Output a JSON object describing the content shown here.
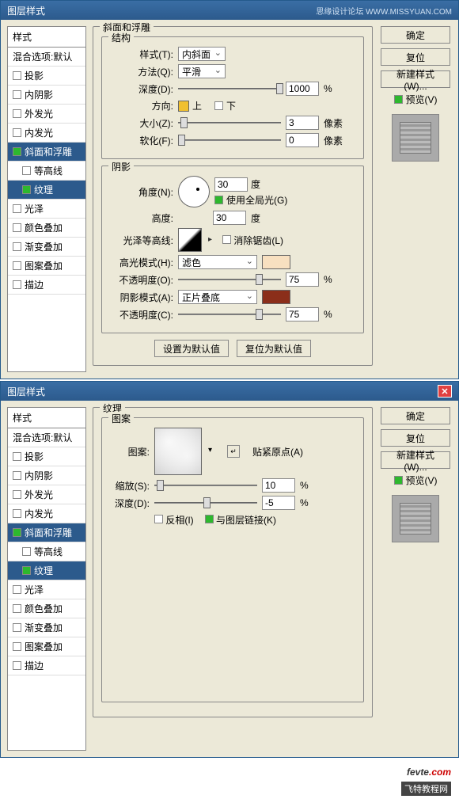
{
  "dialog1": {
    "title": "图层样式",
    "watermark": "思缘设计论坛  WWW.MISSYUAN.COM",
    "styles_header": "样式",
    "blend_default": "混合选项:默认",
    "items": {
      "drop_shadow": "投影",
      "inner_shadow": "内阴影",
      "outer_glow": "外发光",
      "inner_glow": "内发光",
      "bevel": "斜面和浮雕",
      "contour": "等高线",
      "texture": "纹理",
      "satin": "光泽",
      "color_overlay": "颜色叠加",
      "grad_overlay": "渐变叠加",
      "pattern_overlay": "图案叠加",
      "stroke": "描边"
    },
    "panel_title": "斜面和浮雕",
    "structure": {
      "title": "结构",
      "style_lbl": "样式(T):",
      "style_val": "内斜面",
      "method_lbl": "方法(Q):",
      "method_val": "平滑",
      "depth_lbl": "深度(D):",
      "depth_val": "1000",
      "depth_unit": "%",
      "dir_lbl": "方向:",
      "dir_up": "上",
      "dir_down": "下",
      "size_lbl": "大小(Z):",
      "size_val": "3",
      "size_unit": "像素",
      "soften_lbl": "软化(F):",
      "soften_val": "0",
      "soften_unit": "像素"
    },
    "shading": {
      "title": "阴影",
      "angle_lbl": "角度(N):",
      "angle_val": "30",
      "angle_unit": "度",
      "global_light": "使用全局光(G)",
      "altitude_lbl": "高度:",
      "altitude_val": "30",
      "altitude_unit": "度",
      "gloss_lbl": "光泽等高线:",
      "anti_alias": "消除锯齿(L)",
      "hl_mode_lbl": "高光模式(H):",
      "hl_mode_val": "滤色",
      "hl_color": "#f8e0c0",
      "hl_opacity_lbl": "不透明度(O):",
      "hl_opacity_val": "75",
      "pct": "%",
      "sh_mode_lbl": "阴影模式(A):",
      "sh_mode_val": "正片叠底",
      "sh_color": "#8b2e1a",
      "sh_opacity_lbl": "不透明度(C):",
      "sh_opacity_val": "75"
    },
    "btn_default": "设置为默认值",
    "btn_reset": "复位为默认值",
    "side": {
      "ok": "确定",
      "cancel": "复位",
      "new_style": "新建样式(W)...",
      "preview": "预览(V)"
    }
  },
  "dialog2": {
    "title": "图层样式",
    "panel_title": "纹理",
    "pattern": {
      "title": "图案",
      "pattern_lbl": "图案:",
      "snap_lbl": "贴紧原点(A)",
      "scale_lbl": "缩放(S):",
      "scale_val": "10",
      "pct": "%",
      "depth_lbl": "深度(D):",
      "depth_val": "-5",
      "invert": "反相(I)",
      "link": "与图层链接(K)"
    },
    "side": {
      "ok": "确定",
      "cancel": "复位",
      "new_style": "新建样式(W)...",
      "preview": "预览(V)"
    }
  },
  "footer": {
    "brand": "fevte",
    "dot": ".com",
    "sub": "飞特教程网"
  }
}
